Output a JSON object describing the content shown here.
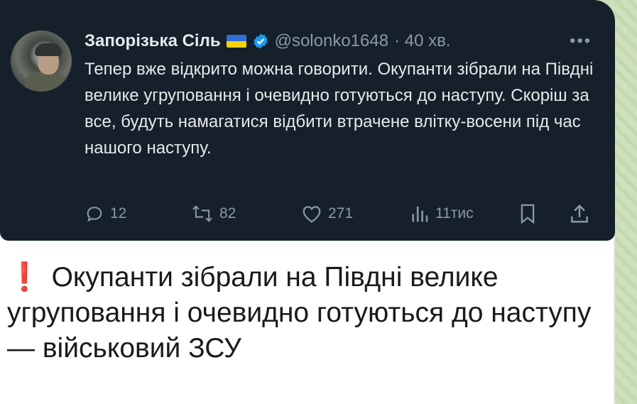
{
  "tweet": {
    "author_name": "Запорізька Сіль",
    "handle": "@solonko1648",
    "time": "· 40 хв.",
    "more": "•••",
    "text": "Тепер вже відкрито можна говорити. Окупанти зібрали на Півдні велике угруповання і очевидно готуються до наступу. Скоріш за все, будуть намагатися відбити втрачене влітку-восени під час нашого наступу.",
    "actions": {
      "replies": "12",
      "reposts": "82",
      "likes": "271",
      "views": "11тис"
    },
    "icons": [
      "reply-icon",
      "repost-icon",
      "like-icon",
      "views-icon",
      "bookmark-icon",
      "share-icon",
      "verified-icon",
      "ukraine-flag-icon"
    ],
    "colors": {
      "background": "#15202b",
      "text": "#e7e9ea",
      "muted": "#8b98a5",
      "verified": "#1d9bf0"
    }
  },
  "caption": {
    "emoji": "❗",
    "text": "Окупанти зібрали на Півдні велике угруповання і очевидно готуються до наступу — військовий ЗСУ"
  }
}
